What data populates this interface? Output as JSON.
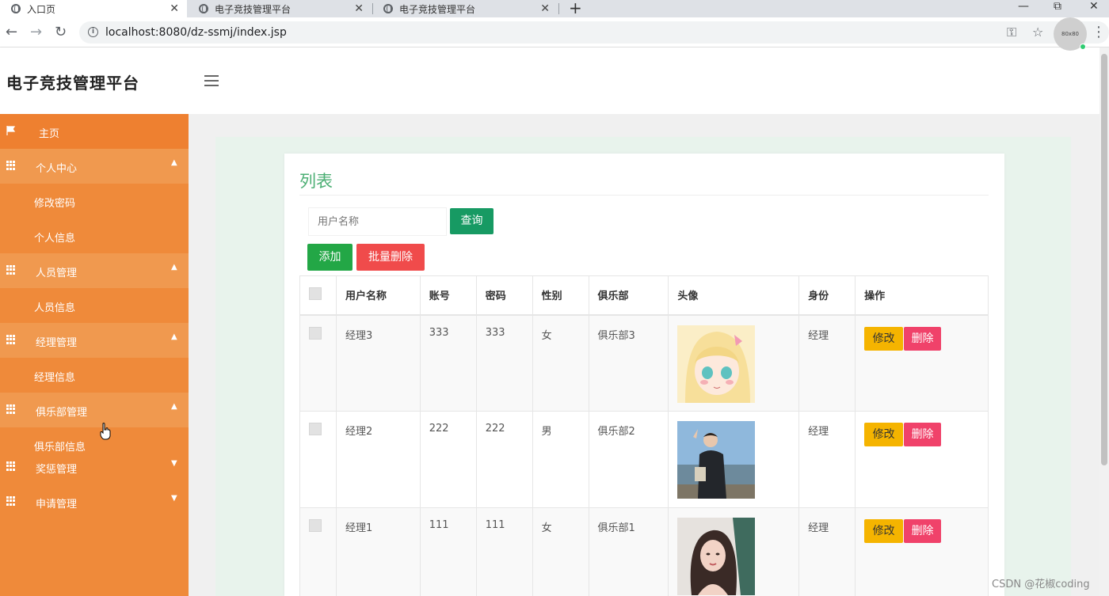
{
  "browser": {
    "tabs": [
      {
        "title": "入口页",
        "close": "✕"
      },
      {
        "title": "电子竞技管理平台",
        "close": "✕"
      },
      {
        "title": "电子竞技管理平台",
        "close": "✕"
      }
    ],
    "new_tab": "+",
    "window_controls": {
      "minimize": "—",
      "restore": "⧉",
      "close": "✕"
    },
    "url": "localhost:8080/dz-ssmj/index.jsp",
    "nav": {
      "back": "←",
      "forward": "→",
      "reload": "↻"
    },
    "icons": {
      "key": "⚿",
      "star": "☆",
      "menu": "⋮",
      "info": "i"
    }
  },
  "header": {
    "brand": "电子竞技管理平台",
    "avatar_text": "80x80"
  },
  "sidebar": {
    "home": {
      "label": "主页"
    },
    "groups": [
      {
        "label": "个人中心",
        "caret": "▲",
        "items": [
          "修改密码",
          "个人信息"
        ]
      },
      {
        "label": "人员管理",
        "caret": "▲",
        "items": [
          "人员信息"
        ]
      },
      {
        "label": "经理管理",
        "caret": "▲",
        "items": [
          "经理信息"
        ]
      },
      {
        "label": "俱乐部管理",
        "caret": "▲",
        "items": [
          "俱乐部信息"
        ]
      },
      {
        "label": "奖惩管理",
        "caret": "▼",
        "items": []
      },
      {
        "label": "申请管理",
        "caret": "▼",
        "items": []
      }
    ]
  },
  "main": {
    "title": "列表",
    "search": {
      "placeholder": "用户名称",
      "value": ""
    },
    "buttons": {
      "query": "查询",
      "add": "添加",
      "batch_delete": "批量删除"
    },
    "table": {
      "columns": [
        "用户名称",
        "账号",
        "密码",
        "性别",
        "俱乐部",
        "头像",
        "身份",
        "操作"
      ],
      "rows": [
        {
          "name": "经理3",
          "account": "333",
          "password": "333",
          "gender": "女",
          "club": "俱乐部3",
          "avatar": "anime-girl-avatar",
          "role": "经理"
        },
        {
          "name": "经理2",
          "account": "222",
          "password": "222",
          "gender": "男",
          "club": "俱乐部2",
          "avatar": "man-outdoor-photo",
          "role": "经理"
        },
        {
          "name": "经理1",
          "account": "111",
          "password": "111",
          "gender": "女",
          "club": "俱乐部1",
          "avatar": "illustrated-woman-portrait",
          "role": "经理"
        }
      ],
      "edit_label": "修改",
      "delete_label": "删除"
    }
  },
  "watermark": "CSDN @花椒coding",
  "colors": {
    "sidebar": "#ef8a3a",
    "sidebar_group": "#f0994f",
    "title_green": "#4caf74",
    "query": "#179a63",
    "add": "#23a746",
    "batch_delete": "#f04b4b",
    "edit": "#f5b400",
    "delete": "#f0426a"
  }
}
